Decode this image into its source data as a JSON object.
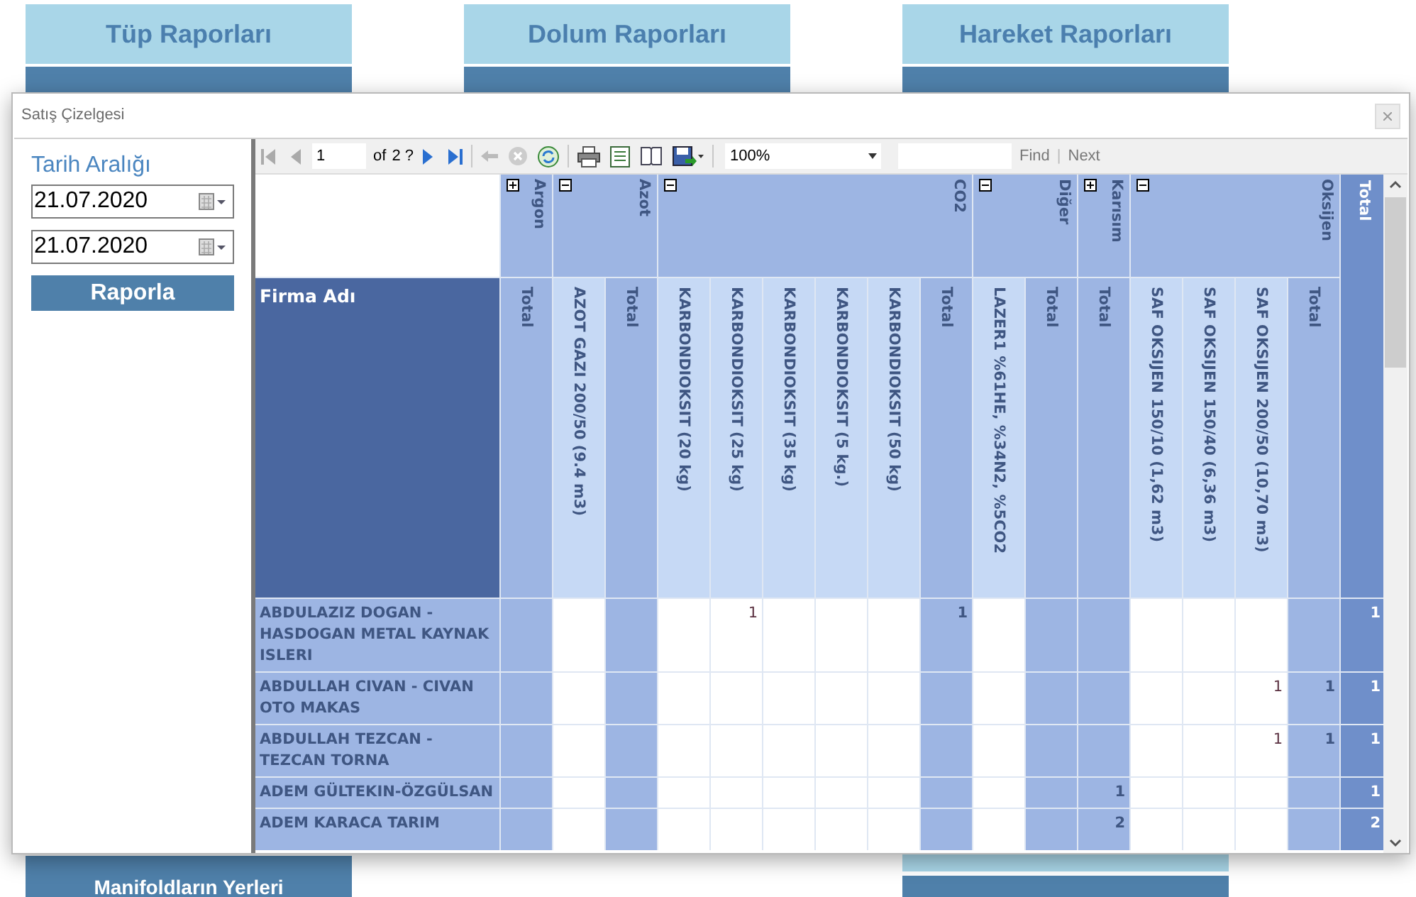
{
  "background_menu": [
    {
      "title": "Tüp Raporları",
      "bottom_items": [
        {
          "kind": "dark",
          "label": "Manifoldların Yerleri"
        }
      ]
    },
    {
      "title": "Dolum Raporları"
    },
    {
      "title": "Hareket Raporları",
      "bottom_items": [
        {
          "kind": "light"
        },
        {
          "kind": "dark_short"
        }
      ]
    }
  ],
  "dialog": {
    "title": "Satış Çizelgesi",
    "filter": {
      "label": "Tarih Aralığı",
      "dates": [
        "21.07.2020",
        "21.07.2020"
      ],
      "button": "Raporla"
    },
    "toolbar": {
      "page": "1",
      "of_label": "of",
      "page_count": "2 ?",
      "zoom": "100%",
      "find": "Find",
      "separator": "|",
      "next": "Next"
    },
    "matrix": {
      "row_header": "Firma Adı",
      "grand_total": "Total",
      "groups": [
        {
          "label": "Argon",
          "expanded": false,
          "columns": [
            {
              "label": "Total",
              "kind": "total"
            }
          ]
        },
        {
          "label": "Azot",
          "expanded": true,
          "columns": [
            {
              "label": "AZOT GAZI 200/50 (9.4 m3)",
              "kind": "product"
            },
            {
              "label": "Total",
              "kind": "total"
            }
          ]
        },
        {
          "label": "CO2",
          "expanded": true,
          "columns": [
            {
              "label": "KARBONDIOKSIT (20 kg)",
              "kind": "product"
            },
            {
              "label": "KARBONDIOKSIT (25 kg)",
              "kind": "product"
            },
            {
              "label": "KARBONDIOKSIT (35 kg)",
              "kind": "product"
            },
            {
              "label": "KARBONDIOKSIT (5 kg.)",
              "kind": "product"
            },
            {
              "label": "KARBONDIOKSIT (50 kg)",
              "kind": "product"
            },
            {
              "label": "Total",
              "kind": "total"
            }
          ]
        },
        {
          "label": "Diğer",
          "expanded": true,
          "columns": [
            {
              "label": "LAZER1 %61HE, %34N2, %5CO2",
              "kind": "product"
            },
            {
              "label": "Total",
              "kind": "total"
            }
          ]
        },
        {
          "label": "Karısım",
          "expanded": false,
          "columns": [
            {
              "label": "Total",
              "kind": "total"
            }
          ]
        },
        {
          "label": "Oksijen",
          "expanded": true,
          "columns": [
            {
              "label": "SAF OKSIJEN 150/10 (1,62 m3)",
              "kind": "product"
            },
            {
              "label": "SAF OKSIJEN 150/40 (6,36 m3)",
              "kind": "product"
            },
            {
              "label": "SAF OKSIJEN 200/50 (10,70 m3)",
              "kind": "product"
            },
            {
              "label": "Total",
              "kind": "total"
            }
          ]
        }
      ],
      "rows": [
        {
          "name": "ABDULAZIZ DOGAN - HASDOGAN METAL KAYNAK ISLERI",
          "cells": [
            {
              "kind": "blank"
            },
            {
              "kind": "blank"
            },
            {
              "kind": "blank"
            },
            {
              "kind": "blank"
            },
            {
              "kind": "filled",
              "text": "1"
            },
            {
              "kind": "blank"
            },
            {
              "kind": "blank"
            },
            {
              "kind": "blank"
            },
            {
              "kind": "filled",
              "text": "1"
            },
            {
              "kind": "blank"
            },
            {
              "kind": "blank"
            },
            {
              "kind": "blank"
            },
            {
              "kind": "blank"
            },
            {
              "kind": "blank"
            },
            {
              "kind": "blank"
            },
            {
              "kind": "blank"
            }
          ],
          "total": "1"
        },
        {
          "name": "ABDULLAH CIVAN - CIVAN OTO MAKAS",
          "cells": [
            {
              "kind": "blank"
            },
            {
              "kind": "blank"
            },
            {
              "kind": "blank"
            },
            {
              "kind": "blank"
            },
            {
              "kind": "blank"
            },
            {
              "kind": "blank"
            },
            {
              "kind": "blank"
            },
            {
              "kind": "blank"
            },
            {
              "kind": "blank"
            },
            {
              "kind": "blank"
            },
            {
              "kind": "blank"
            },
            {
              "kind": "blank"
            },
            {
              "kind": "blank"
            },
            {
              "kind": "blank"
            },
            {
              "kind": "filled",
              "text": "1"
            },
            {
              "kind": "filled",
              "text": "1"
            }
          ],
          "total": "1"
        },
        {
          "name": "ABDULLAH TEZCAN - TEZCAN TORNA",
          "cells": [
            {
              "kind": "blank"
            },
            {
              "kind": "blank"
            },
            {
              "kind": "blank"
            },
            {
              "kind": "blank"
            },
            {
              "kind": "blank"
            },
            {
              "kind": "blank"
            },
            {
              "kind": "blank"
            },
            {
              "kind": "blank"
            },
            {
              "kind": "blank"
            },
            {
              "kind": "blank"
            },
            {
              "kind": "blank"
            },
            {
              "kind": "blank"
            },
            {
              "kind": "blank"
            },
            {
              "kind": "blank"
            },
            {
              "kind": "filled",
              "text": "1"
            },
            {
              "kind": "filled",
              "text": "1"
            }
          ],
          "total": "1"
        },
        {
          "name": "ADEM GÜLTEKIN-ÖZGÜLSAN",
          "cells": [
            {
              "kind": "blank"
            },
            {
              "kind": "blank"
            },
            {
              "kind": "blank"
            },
            {
              "kind": "blank"
            },
            {
              "kind": "blank"
            },
            {
              "kind": "blank"
            },
            {
              "kind": "blank"
            },
            {
              "kind": "blank"
            },
            {
              "kind": "blank"
            },
            {
              "kind": "blank"
            },
            {
              "kind": "blank"
            },
            {
              "kind": "filled",
              "text": "1"
            },
            {
              "kind": "blank"
            },
            {
              "kind": "blank"
            },
            {
              "kind": "blank"
            },
            {
              "kind": "blank"
            }
          ],
          "total": "1"
        },
        {
          "name": "ADEM KARACA TARIM",
          "cells": [
            {
              "kind": "blank"
            },
            {
              "kind": "blank"
            },
            {
              "kind": "blank"
            },
            {
              "kind": "blank"
            },
            {
              "kind": "blank"
            },
            {
              "kind": "blank"
            },
            {
              "kind": "blank"
            },
            {
              "kind": "blank"
            },
            {
              "kind": "blank"
            },
            {
              "kind": "blank"
            },
            {
              "kind": "blank"
            },
            {
              "kind": "filled",
              "text": "2"
            },
            {
              "kind": "blank"
            },
            {
              "kind": "blank"
            },
            {
              "kind": "blank"
            },
            {
              "kind": "blank"
            }
          ],
          "total": "2"
        }
      ]
    }
  }
}
